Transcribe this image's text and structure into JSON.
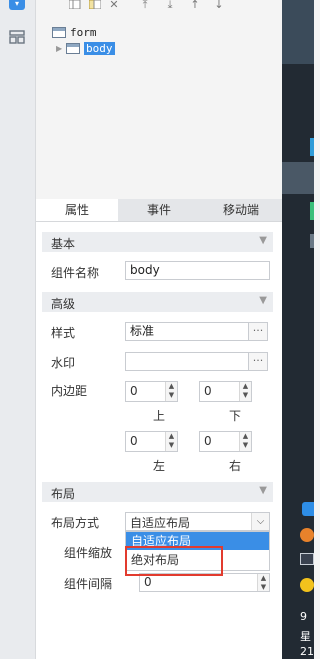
{
  "tree": {
    "root": "form",
    "child": "body"
  },
  "tabs": [
    "属性",
    "事件",
    "移动端"
  ],
  "sections": {
    "basic": "基本",
    "advanced": "高级",
    "layout": "布局"
  },
  "fields": {
    "component_name_label": "组件名称",
    "component_name_value": "body",
    "style_label": "样式",
    "style_value": "标准",
    "watermark_label": "水印",
    "watermark_value": "",
    "padding_label": "内边距",
    "padding_top": "0",
    "padding_bottom": "0",
    "padding_left": "0",
    "padding_right": "0",
    "cap_top": "上",
    "cap_bottom": "下",
    "cap_left": "左",
    "cap_right": "右",
    "layout_mode_label": "布局方式",
    "layout_mode_value": "自适应布局",
    "zoom_label": "组件缩放",
    "spacing_label": "组件间隔",
    "spacing_value": "0"
  },
  "dropdown": {
    "options": [
      "自适应布局",
      "绝对布局"
    ],
    "highlighted_index": 0
  },
  "taskbar": {
    "time_partial": "9",
    "weekday_partial": "星",
    "date_partial": "21"
  }
}
